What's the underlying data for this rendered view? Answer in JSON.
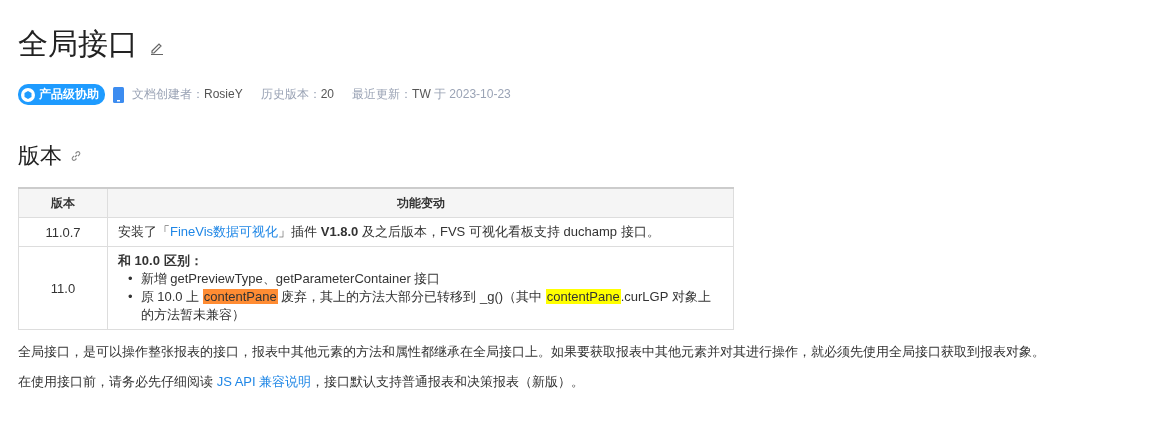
{
  "title": "全局接口",
  "badge": "产品级协助",
  "meta": [
    {
      "label": "文档创建者：",
      "value": "RosieY"
    },
    {
      "label": "历史版本：",
      "value": "20"
    },
    {
      "label": "最近更新：",
      "value": "TW",
      "suffix": " 于 2023-10-23"
    }
  ],
  "section_title": "版本",
  "table": {
    "columns": [
      "版本",
      "功能变动"
    ],
    "rows": [
      {
        "version": "11.0.7",
        "kind": "sentence",
        "parts": [
          {
            "kind": "text",
            "text": "安装了「"
          },
          {
            "kind": "link",
            "text": "FineVis数据可视化"
          },
          {
            "kind": "text",
            "text": "」插件 **V1.8.0** 及之后版本，FVS 可视化看板支持 duchamp 接口。"
          }
        ]
      },
      {
        "version": "11.0",
        "kind": "list",
        "heading": "和 10.0 区别：",
        "bullets": [
          {
            "marker": "•",
            "segments": [
              {
                "text": "新增 getPreviewType、getParameterContainer 接口"
              }
            ]
          },
          {
            "marker": "•",
            "segments": [
              {
                "text": "原 10.0 上 "
              },
              {
                "text": "contentPane",
                "color": "#ff8c33"
              },
              {
                "text": " 废弃，其上的方法大部分已转移到 _g()（其中 "
              },
              {
                "text": "contentPane",
                "color": "#ffff00"
              },
              {
                "text": ".curLGP 对象上的方法暂未兼容）"
              }
            ]
          }
        ]
      }
    ]
  },
  "paragraphs": [
    [
      {
        "kind": "text",
        "text": "全局接口，是可以操作整张报表的接口，报表中其他元素的方法和属性都继承在全局接口上。如果要获取报表中其他元素并对其进行操作，就必须先使用全局接口获取到报表对象。"
      }
    ],
    [
      {
        "kind": "text",
        "text": "在使用接口前，请务必先仔细阅读 "
      },
      {
        "kind": "link",
        "text": "JS API 兼容说明"
      },
      {
        "kind": "text",
        "text": "，接口默认支持普通报表和决策报表（新版）。"
      }
    ]
  ]
}
